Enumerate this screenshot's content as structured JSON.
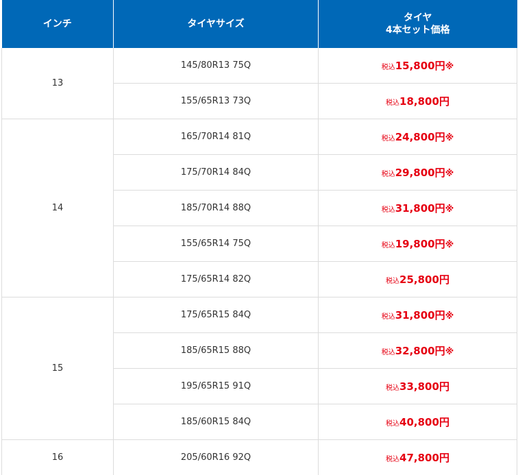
{
  "header": {
    "inch": "インチ",
    "size": "タイヤサイズ",
    "price_line1": "タイヤ",
    "price_line2": "4本セット価格"
  },
  "tax_label": "税込",
  "currency_unit": "円",
  "note_mark": "※",
  "colors": {
    "header_bg": "#0068b7",
    "price_red": "#e60012",
    "border": "#dcdcdc"
  },
  "groups": [
    {
      "inch": "13",
      "rows": [
        {
          "size": "145/80R13 75Q",
          "price": "15,800",
          "note": true
        },
        {
          "size": "155/65R13 73Q",
          "price": "18,800",
          "note": false
        }
      ]
    },
    {
      "inch": "14",
      "rows": [
        {
          "size": "165/70R14 81Q",
          "price": "24,800",
          "note": true
        },
        {
          "size": "175/70R14 84Q",
          "price": "29,800",
          "note": true
        },
        {
          "size": "185/70R14 88Q",
          "price": "31,800",
          "note": true
        },
        {
          "size": "155/65R14 75Q",
          "price": "19,800",
          "note": true
        },
        {
          "size": "175/65R14 82Q",
          "price": "25,800",
          "note": false
        }
      ]
    },
    {
      "inch": "15",
      "rows": [
        {
          "size": "175/65R15 84Q",
          "price": "31,800",
          "note": true
        },
        {
          "size": "185/65R15 88Q",
          "price": "32,800",
          "note": true
        },
        {
          "size": "195/65R15 91Q",
          "price": "33,800",
          "note": false
        },
        {
          "size": "185/60R15 84Q",
          "price": "40,800",
          "note": false
        }
      ]
    },
    {
      "inch": "16",
      "rows": [
        {
          "size": "205/60R16 92Q",
          "price": "47,800",
          "note": false
        }
      ]
    }
  ]
}
